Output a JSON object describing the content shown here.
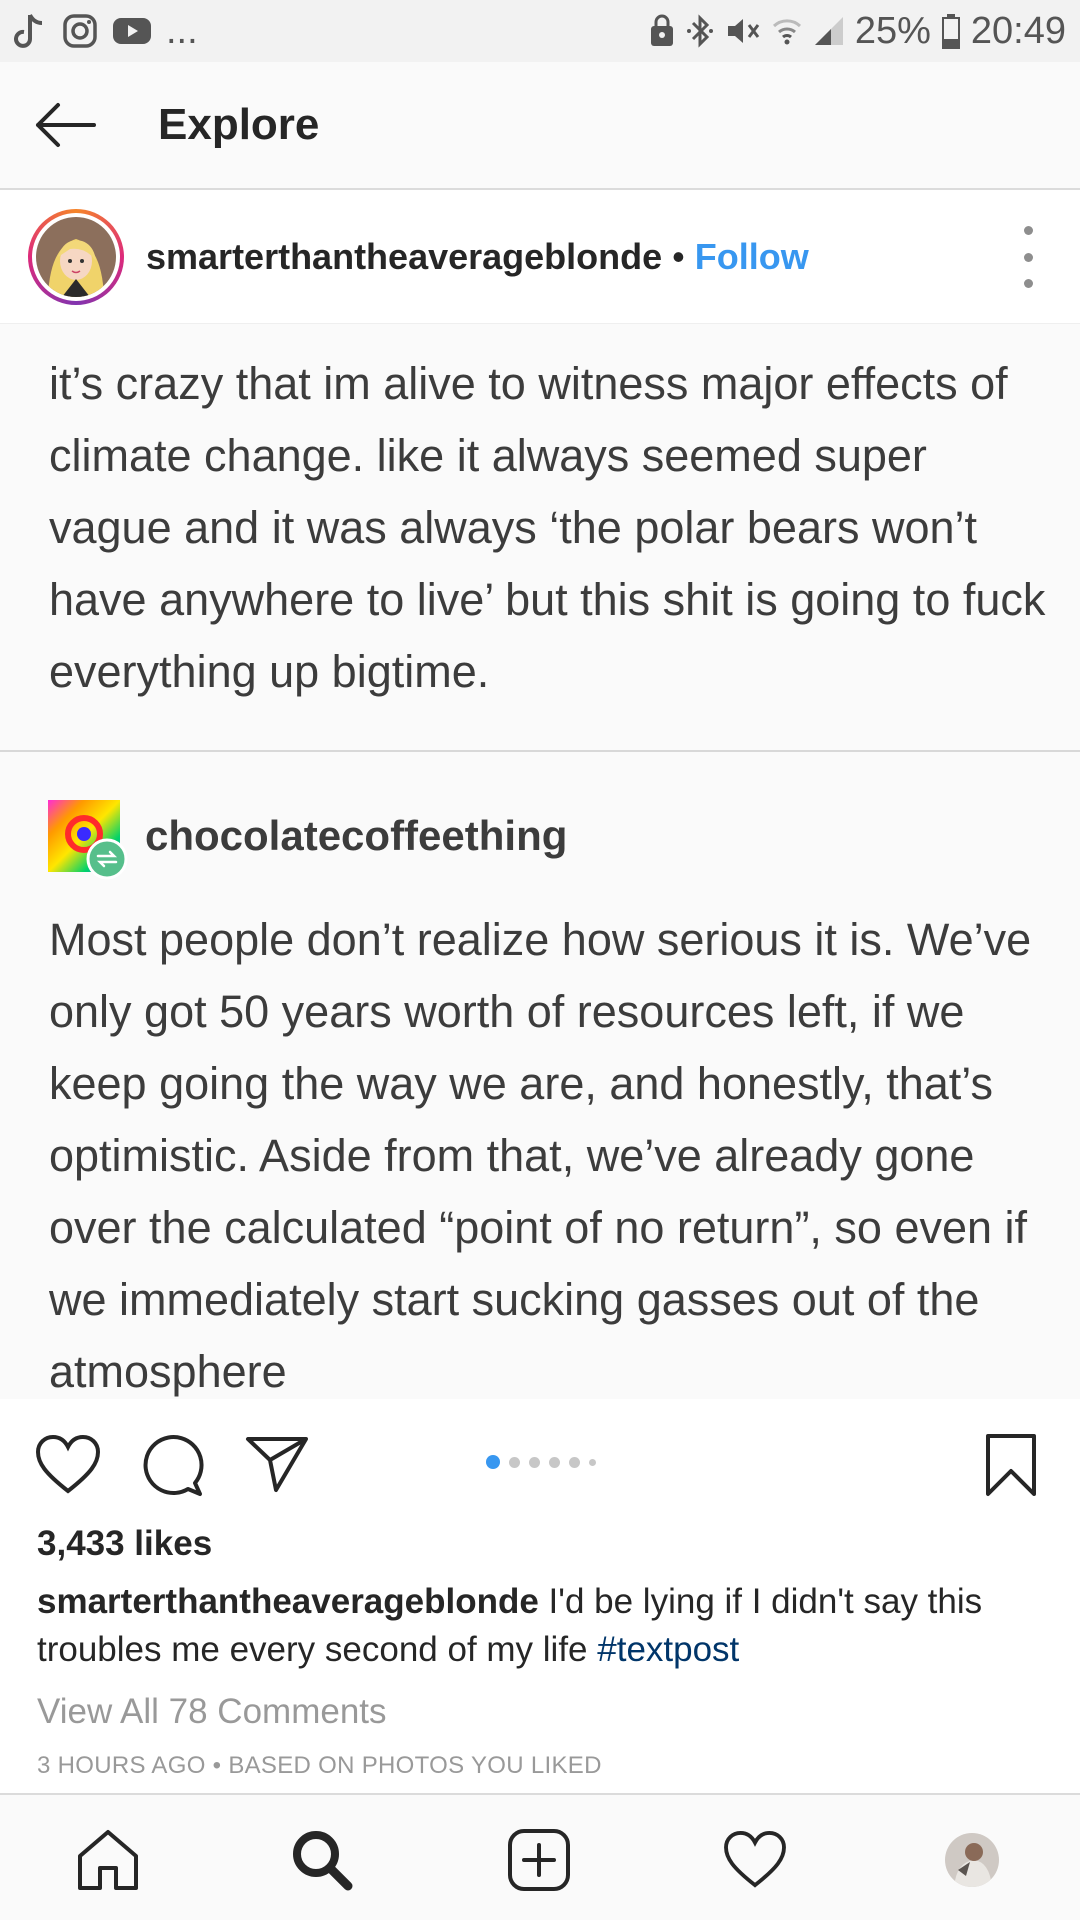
{
  "status_bar": {
    "battery_percent": "25%",
    "time": "20:49",
    "overflow": "...",
    "left_icons": [
      "tiktok-icon",
      "instagram-icon",
      "youtube-icon"
    ],
    "right_icons": [
      "lock-icon",
      "bluetooth-icon",
      "mute-icon",
      "wifi-icon",
      "signal-icon",
      "battery-icon"
    ]
  },
  "header": {
    "title": "Explore"
  },
  "post": {
    "username": "smarterthantheaverageblonde",
    "separator": "•",
    "follow_label": "Follow",
    "image": {
      "original_text": "it’s crazy that im alive to witness major effects of climate change. like it always seemed super vague and it was always ‘the polar bears won’t have anywhere to live’ but this shit is going to fuck everything up bigtime.",
      "reblog_user": "chocolatecoffeething",
      "reblog_text": "Most people don’t realize how serious it is. We’ve only got 50 years worth of resources left, if we keep going the way we are, and honestly, that’s optimistic. Aside from that, we’ve already gone over the calculated “point of no return”, so even if we immediately start sucking gasses out of the atmosphere"
    },
    "carousel": {
      "total": 6,
      "active": 1
    },
    "likes": "3,433 likes",
    "caption_user": "smarterthantheaverageblonde",
    "caption_text": " I'd be lying if I didn't say this troubles me every second of my life ",
    "hashtag": "#textpost",
    "view_comments": "View All 78 Comments",
    "timestamp": "3 HOURS AGO • BASED ON PHOTOS YOU LIKED"
  },
  "colors": {
    "accent": "#3897f0",
    "hashtag": "#003569",
    "muted": "#999999",
    "text": "#262626"
  },
  "bottom_nav": [
    "home-icon",
    "search-icon",
    "add-post-icon",
    "activity-heart-icon",
    "profile-avatar"
  ]
}
